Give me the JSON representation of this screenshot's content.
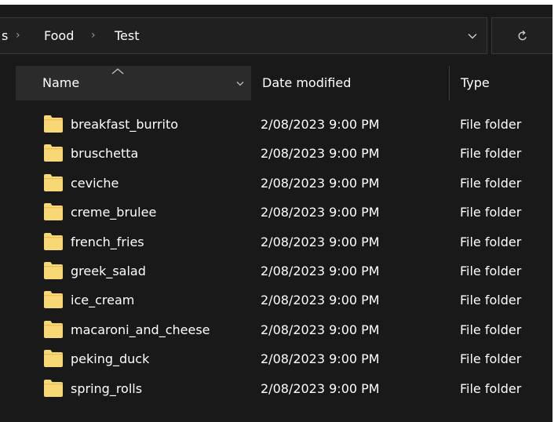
{
  "breadcrumb": {
    "prev_fragment": "s",
    "segments": [
      "Food",
      "Test"
    ]
  },
  "icons": {
    "breadcrumb_separator": "chevron-right-icon",
    "history": "chevron-down-icon",
    "refresh": "refresh-icon",
    "sort": "sort-ascending-icon",
    "folder": "folder-icon"
  },
  "columns": {
    "name": "Name",
    "date": "Date modified",
    "type": "Type"
  },
  "rows": [
    {
      "name": "breakfast_burrito",
      "date": "2/08/2023 9:00 PM",
      "type": "File folder"
    },
    {
      "name": "bruschetta",
      "date": "2/08/2023 9:00 PM",
      "type": "File folder"
    },
    {
      "name": "ceviche",
      "date": "2/08/2023 9:00 PM",
      "type": "File folder"
    },
    {
      "name": "creme_brulee",
      "date": "2/08/2023 9:00 PM",
      "type": "File folder"
    },
    {
      "name": "french_fries",
      "date": "2/08/2023 9:00 PM",
      "type": "File folder"
    },
    {
      "name": "greek_salad",
      "date": "2/08/2023 9:00 PM",
      "type": "File folder"
    },
    {
      "name": "ice_cream",
      "date": "2/08/2023 9:00 PM",
      "type": "File folder"
    },
    {
      "name": "macaroni_and_cheese",
      "date": "2/08/2023 9:00 PM",
      "type": "File folder"
    },
    {
      "name": "peking_duck",
      "date": "2/08/2023 9:00 PM",
      "type": "File folder"
    },
    {
      "name": "spring_rolls",
      "date": "2/08/2023 9:00 PM",
      "type": "File folder"
    }
  ],
  "colors": {
    "background": "#191919",
    "text": "#ffffff",
    "folder": "#f8d775"
  }
}
